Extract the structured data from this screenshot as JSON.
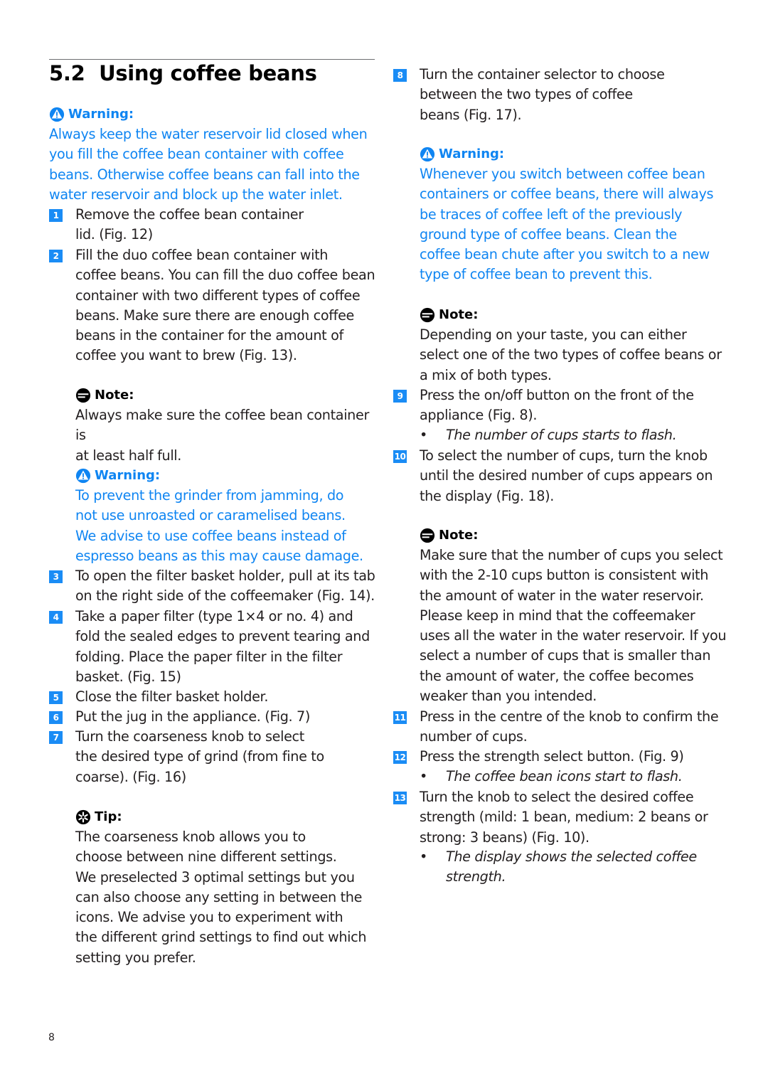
{
  "section": {
    "number": "5.2",
    "title": "Using coffee beans"
  },
  "icons": {
    "warning": "warning-triangle-icon",
    "note": "note-icon",
    "tip": "tip-asterisk-icon"
  },
  "colors": {
    "accent_blue": "#0f85f2",
    "step_badge": "#1a8cf5",
    "text": "#231f20"
  },
  "left": {
    "warning1": {
      "label": "Warning:",
      "lines": [
        "Always keep the water reservoir lid closed when",
        "you fill the coffee bean container with coffee",
        "beans. Otherwise coffee beans can fall into the",
        "water reservoir and block up the water inlet."
      ]
    },
    "steps": [
      {
        "num": "1",
        "lines": [
          "Remove the coffee bean container",
          "lid.  (Fig. 12)"
        ]
      },
      {
        "num": "2",
        "lines": [
          "Fill the duo coffee bean container with",
          "coffee beans. You can fill the duo coffee bean",
          "container with two different types of coffee",
          "beans. Make sure there are enough coffee",
          "beans in the container for the amount of",
          "coffee you want to brew (Fig. 13)."
        ]
      },
      {
        "num": "3",
        "lines": [
          "To open the filter basket holder, pull at its tab",
          "on the right side of the coffeemaker (Fig. 14)."
        ]
      },
      {
        "num": "4",
        "lines": [
          "Take a paper filter (type 1×4 or no. 4) and",
          "fold the sealed edges to prevent tearing and",
          "folding. Place the paper filter in the filter",
          "basket.  (Fig. 15)"
        ]
      },
      {
        "num": "5",
        "lines": [
          "Close the filter basket holder."
        ]
      },
      {
        "num": "6",
        "lines": [
          "Put the jug in the appliance.  (Fig. 7)"
        ]
      },
      {
        "num": "7",
        "lines": [
          "Turn the coarseness knob to select",
          "the desired type of grind (from fine to",
          "coarse).  (Fig. 16)"
        ]
      }
    ],
    "note1": {
      "label": "Note:",
      "lines": [
        "Always make sure the coffee bean container is",
        "at least half full."
      ]
    },
    "warning2": {
      "label": "Warning:",
      "lines": [
        "To prevent the grinder from jamming, do",
        "not use unroasted or caramelised beans.",
        "We advise to use coffee beans instead of",
        "espresso beans as this may cause damage."
      ]
    },
    "tip": {
      "label": "Tip:",
      "lines": [
        "The coarseness knob allows you to",
        "choose between nine different settings.",
        "We preselected 3 optimal settings but you",
        "can also choose any setting in between the",
        "icons. We advise you to experiment with",
        "the different grind settings to find out which",
        "setting you prefer."
      ]
    }
  },
  "right": {
    "steps": [
      {
        "num": "8",
        "lines": [
          "Turn the container selector to choose",
          "between the two types of coffee",
          "beans (Fig. 17)."
        ]
      },
      {
        "num": "9",
        "lines": [
          "Press the on/off button on the front of the",
          "appliance (Fig. 8)."
        ]
      },
      {
        "num": "10",
        "lines": [
          "To select the number of cups, turn the knob",
          "until the desired number of cups appears on",
          "the display (Fig. 18)."
        ]
      },
      {
        "num": "11",
        "lines": [
          "Press in the centre of the knob to confirm the",
          "number of cups."
        ]
      },
      {
        "num": "12",
        "lines": [
          "Press the strength select button.  (Fig. 9)"
        ]
      },
      {
        "num": "13",
        "lines": [
          "Turn the knob to select the desired coffee",
          "strength (mild: 1 bean, medium: 2 beans or",
          "strong: 3 beans) (Fig. 10)."
        ]
      }
    ],
    "warning": {
      "label": "Warning:",
      "lines": [
        "Whenever you switch between coffee bean",
        "containers or coffee beans, there will always",
        "be traces of coffee left of the previously",
        "ground type of coffee beans. Clean the",
        "coffee bean chute after you switch to a new",
        "type of coffee bean to prevent this."
      ]
    },
    "note1": {
      "label": "Note:",
      "lines": [
        "Depending on your taste, you can either",
        "select one of the two types of coffee beans or",
        "a mix of both types."
      ]
    },
    "note2": {
      "label": "Note:",
      "lines": [
        "Make sure that the number of cups you select",
        "with the 2-10 cups button is consistent with",
        "the amount of water in the water reservoir.",
        "Please keep in mind that the coffeemaker",
        "uses all the water in the water reservoir. If you",
        "select a number of cups that is smaller than",
        "the amount of water, the coffee becomes",
        "weaker than you intended."
      ]
    },
    "bullets": {
      "b9": {
        "dot": "•",
        "lines": [
          "The number of cups starts to flash."
        ]
      },
      "b12": {
        "dot": "•",
        "lines": [
          "The coffee bean icons start to flash."
        ]
      },
      "b13": {
        "dot": "•",
        "lines": [
          "The display shows the selected coffee",
          "strength."
        ]
      }
    }
  },
  "footer": {
    "page_number": "8"
  }
}
